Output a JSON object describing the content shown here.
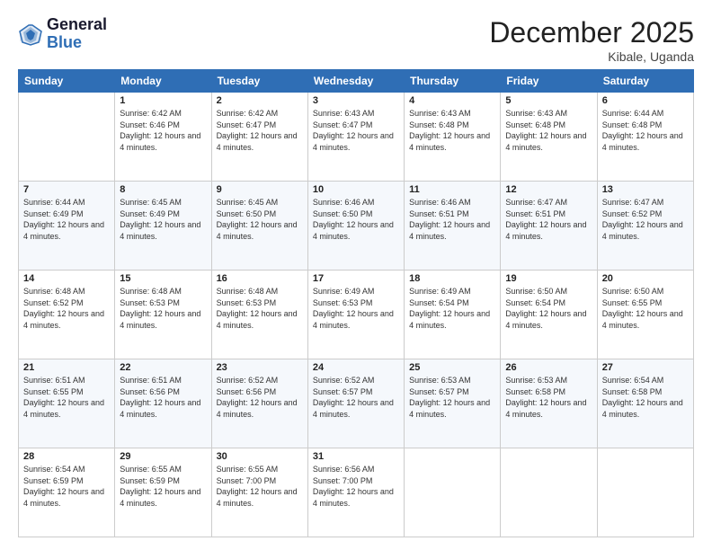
{
  "logo": {
    "line1": "General",
    "line2": "Blue"
  },
  "title": "December 2025",
  "location": "Kibale, Uganda",
  "weekdays": [
    "Sunday",
    "Monday",
    "Tuesday",
    "Wednesday",
    "Thursday",
    "Friday",
    "Saturday"
  ],
  "weeks": [
    [
      {
        "day": "",
        "sunrise": "",
        "sunset": "",
        "daylight": ""
      },
      {
        "day": "1",
        "sunrise": "Sunrise: 6:42 AM",
        "sunset": "Sunset: 6:46 PM",
        "daylight": "Daylight: 12 hours and 4 minutes."
      },
      {
        "day": "2",
        "sunrise": "Sunrise: 6:42 AM",
        "sunset": "Sunset: 6:47 PM",
        "daylight": "Daylight: 12 hours and 4 minutes."
      },
      {
        "day": "3",
        "sunrise": "Sunrise: 6:43 AM",
        "sunset": "Sunset: 6:47 PM",
        "daylight": "Daylight: 12 hours and 4 minutes."
      },
      {
        "day": "4",
        "sunrise": "Sunrise: 6:43 AM",
        "sunset": "Sunset: 6:48 PM",
        "daylight": "Daylight: 12 hours and 4 minutes."
      },
      {
        "day": "5",
        "sunrise": "Sunrise: 6:43 AM",
        "sunset": "Sunset: 6:48 PM",
        "daylight": "Daylight: 12 hours and 4 minutes."
      },
      {
        "day": "6",
        "sunrise": "Sunrise: 6:44 AM",
        "sunset": "Sunset: 6:48 PM",
        "daylight": "Daylight: 12 hours and 4 minutes."
      }
    ],
    [
      {
        "day": "7",
        "sunrise": "Sunrise: 6:44 AM",
        "sunset": "Sunset: 6:49 PM",
        "daylight": "Daylight: 12 hours and 4 minutes."
      },
      {
        "day": "8",
        "sunrise": "Sunrise: 6:45 AM",
        "sunset": "Sunset: 6:49 PM",
        "daylight": "Daylight: 12 hours and 4 minutes."
      },
      {
        "day": "9",
        "sunrise": "Sunrise: 6:45 AM",
        "sunset": "Sunset: 6:50 PM",
        "daylight": "Daylight: 12 hours and 4 minutes."
      },
      {
        "day": "10",
        "sunrise": "Sunrise: 6:46 AM",
        "sunset": "Sunset: 6:50 PM",
        "daylight": "Daylight: 12 hours and 4 minutes."
      },
      {
        "day": "11",
        "sunrise": "Sunrise: 6:46 AM",
        "sunset": "Sunset: 6:51 PM",
        "daylight": "Daylight: 12 hours and 4 minutes."
      },
      {
        "day": "12",
        "sunrise": "Sunrise: 6:47 AM",
        "sunset": "Sunset: 6:51 PM",
        "daylight": "Daylight: 12 hours and 4 minutes."
      },
      {
        "day": "13",
        "sunrise": "Sunrise: 6:47 AM",
        "sunset": "Sunset: 6:52 PM",
        "daylight": "Daylight: 12 hours and 4 minutes."
      }
    ],
    [
      {
        "day": "14",
        "sunrise": "Sunrise: 6:48 AM",
        "sunset": "Sunset: 6:52 PM",
        "daylight": "Daylight: 12 hours and 4 minutes."
      },
      {
        "day": "15",
        "sunrise": "Sunrise: 6:48 AM",
        "sunset": "Sunset: 6:53 PM",
        "daylight": "Daylight: 12 hours and 4 minutes."
      },
      {
        "day": "16",
        "sunrise": "Sunrise: 6:48 AM",
        "sunset": "Sunset: 6:53 PM",
        "daylight": "Daylight: 12 hours and 4 minutes."
      },
      {
        "day": "17",
        "sunrise": "Sunrise: 6:49 AM",
        "sunset": "Sunset: 6:53 PM",
        "daylight": "Daylight: 12 hours and 4 minutes."
      },
      {
        "day": "18",
        "sunrise": "Sunrise: 6:49 AM",
        "sunset": "Sunset: 6:54 PM",
        "daylight": "Daylight: 12 hours and 4 minutes."
      },
      {
        "day": "19",
        "sunrise": "Sunrise: 6:50 AM",
        "sunset": "Sunset: 6:54 PM",
        "daylight": "Daylight: 12 hours and 4 minutes."
      },
      {
        "day": "20",
        "sunrise": "Sunrise: 6:50 AM",
        "sunset": "Sunset: 6:55 PM",
        "daylight": "Daylight: 12 hours and 4 minutes."
      }
    ],
    [
      {
        "day": "21",
        "sunrise": "Sunrise: 6:51 AM",
        "sunset": "Sunset: 6:55 PM",
        "daylight": "Daylight: 12 hours and 4 minutes."
      },
      {
        "day": "22",
        "sunrise": "Sunrise: 6:51 AM",
        "sunset": "Sunset: 6:56 PM",
        "daylight": "Daylight: 12 hours and 4 minutes."
      },
      {
        "day": "23",
        "sunrise": "Sunrise: 6:52 AM",
        "sunset": "Sunset: 6:56 PM",
        "daylight": "Daylight: 12 hours and 4 minutes."
      },
      {
        "day": "24",
        "sunrise": "Sunrise: 6:52 AM",
        "sunset": "Sunset: 6:57 PM",
        "daylight": "Daylight: 12 hours and 4 minutes."
      },
      {
        "day": "25",
        "sunrise": "Sunrise: 6:53 AM",
        "sunset": "Sunset: 6:57 PM",
        "daylight": "Daylight: 12 hours and 4 minutes."
      },
      {
        "day": "26",
        "sunrise": "Sunrise: 6:53 AM",
        "sunset": "Sunset: 6:58 PM",
        "daylight": "Daylight: 12 hours and 4 minutes."
      },
      {
        "day": "27",
        "sunrise": "Sunrise: 6:54 AM",
        "sunset": "Sunset: 6:58 PM",
        "daylight": "Daylight: 12 hours and 4 minutes."
      }
    ],
    [
      {
        "day": "28",
        "sunrise": "Sunrise: 6:54 AM",
        "sunset": "Sunset: 6:59 PM",
        "daylight": "Daylight: 12 hours and 4 minutes."
      },
      {
        "day": "29",
        "sunrise": "Sunrise: 6:55 AM",
        "sunset": "Sunset: 6:59 PM",
        "daylight": "Daylight: 12 hours and 4 minutes."
      },
      {
        "day": "30",
        "sunrise": "Sunrise: 6:55 AM",
        "sunset": "Sunset: 7:00 PM",
        "daylight": "Daylight: 12 hours and 4 minutes."
      },
      {
        "day": "31",
        "sunrise": "Sunrise: 6:56 AM",
        "sunset": "Sunset: 7:00 PM",
        "daylight": "Daylight: 12 hours and 4 minutes."
      },
      {
        "day": "",
        "sunrise": "",
        "sunset": "",
        "daylight": ""
      },
      {
        "day": "",
        "sunrise": "",
        "sunset": "",
        "daylight": ""
      },
      {
        "day": "",
        "sunrise": "",
        "sunset": "",
        "daylight": ""
      }
    ]
  ]
}
